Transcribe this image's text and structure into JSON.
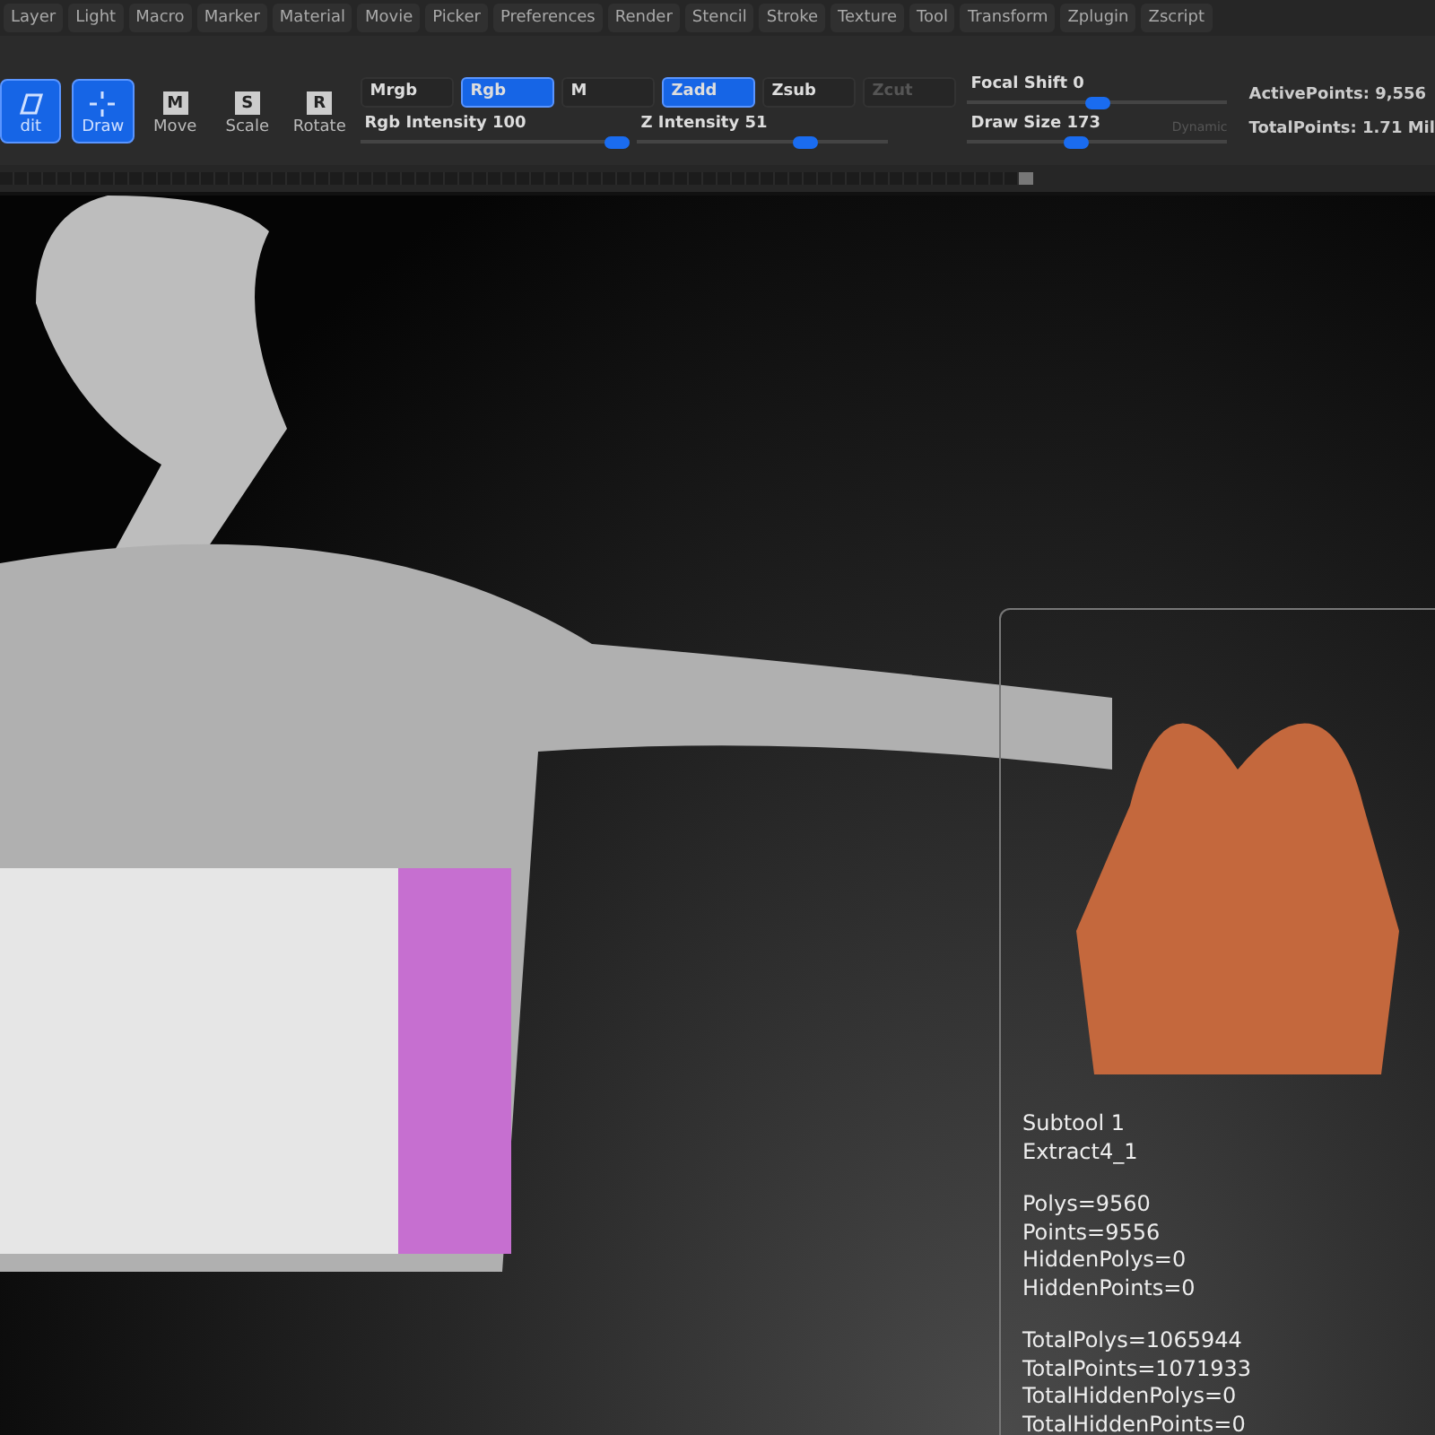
{
  "menu": [
    "Layer",
    "Light",
    "Macro",
    "Marker",
    "Material",
    "Movie",
    "Picker",
    "Preferences",
    "Render",
    "Stencil",
    "Stroke",
    "Texture",
    "Tool",
    "Transform",
    "Zplugin",
    "Zscript"
  ],
  "tools": [
    {
      "kind": "edit",
      "label": "dit",
      "selected": true
    },
    {
      "kind": "draw",
      "label": "Draw",
      "selected": true
    },
    {
      "kind": "move",
      "label": "Move",
      "key": "M",
      "selected": false
    },
    {
      "kind": "scale",
      "label": "Scale",
      "key": "S",
      "selected": false
    },
    {
      "kind": "rotate",
      "label": "Rotate",
      "key": "R",
      "selected": false
    }
  ],
  "color_modes": [
    {
      "label": "Mrgb",
      "selected": false
    },
    {
      "label": "Rgb",
      "selected": true
    },
    {
      "label": "M",
      "selected": false
    }
  ],
  "z_modes": [
    {
      "label": "Zadd",
      "selected": true,
      "disabled": false
    },
    {
      "label": "Zsub",
      "selected": false,
      "disabled": false
    },
    {
      "label": "Zcut",
      "selected": false,
      "disabled": true
    }
  ],
  "sliders": [
    {
      "label": "Rgb  Intensity 100",
      "level": 0.95
    },
    {
      "label": "Z  Intensity 51",
      "level": 0.67
    },
    {
      "label": "Focal  Shift 0",
      "level": 0.5
    },
    {
      "label": "Draw  Size 173",
      "level": 0.42,
      "note": "Dynamic"
    }
  ],
  "stats": [
    "ActivePoints: 9,556",
    "TotalPoints: 1.71  Mil"
  ],
  "info": [
    [
      "Subtool 1",
      "Extract4_1"
    ],
    [
      "Polys=9560",
      "Points=9556",
      "HiddenPolys=0",
      "HiddenPoints=0"
    ],
    [
      "TotalPolys=1065944",
      "TotalPoints=1071933",
      "TotalHiddenPolys=0",
      "TotalHiddenPoints=0"
    ]
  ]
}
